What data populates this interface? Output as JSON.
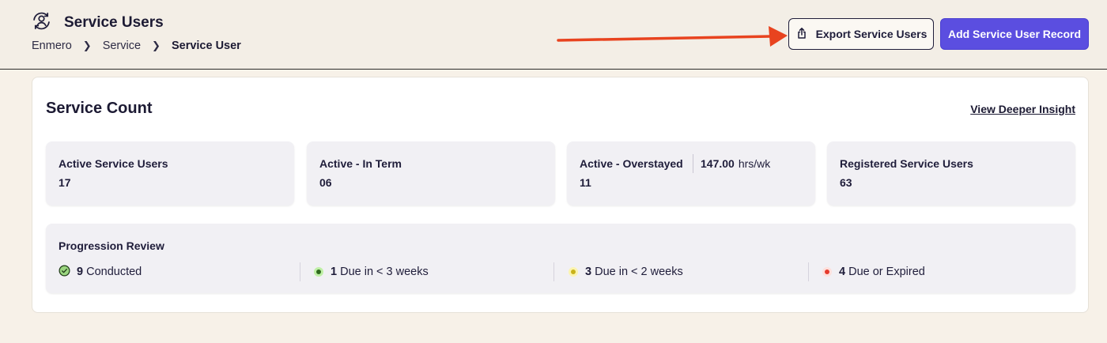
{
  "header": {
    "title": "Service Users",
    "icon": "user-sync-icon",
    "breadcrumb": [
      "Enmero",
      "Service",
      "Service User"
    ],
    "export_button": "Export Service Users",
    "add_button": "Add Service User Record",
    "accent_color": "#5b4ee0",
    "annotation_arrow_color": "#e8431f"
  },
  "service_count": {
    "title": "Service Count",
    "link": "View Deeper Insight",
    "stats": [
      {
        "label": "Active Service Users",
        "value": "17"
      },
      {
        "label": "Active - In Term",
        "value": "06"
      },
      {
        "label": "Active - Overstayed",
        "value": "11",
        "extra_value": "147.00",
        "extra_unit": "hrs/wk"
      },
      {
        "label": "Registered Service Users",
        "value": "63"
      }
    ]
  },
  "progression_review": {
    "title": "Progression Review",
    "items": [
      {
        "count": "9",
        "label": "Conducted",
        "icon": "check-circle-icon"
      },
      {
        "count": "1",
        "label": "Due in < 3 weeks",
        "icon": "green-dot-icon"
      },
      {
        "count": "3",
        "label": "Due in < 2 weeks",
        "icon": "yellow-dot-icon"
      },
      {
        "count": "4",
        "label": "Due or Expired",
        "icon": "red-dot-icon"
      }
    ]
  }
}
